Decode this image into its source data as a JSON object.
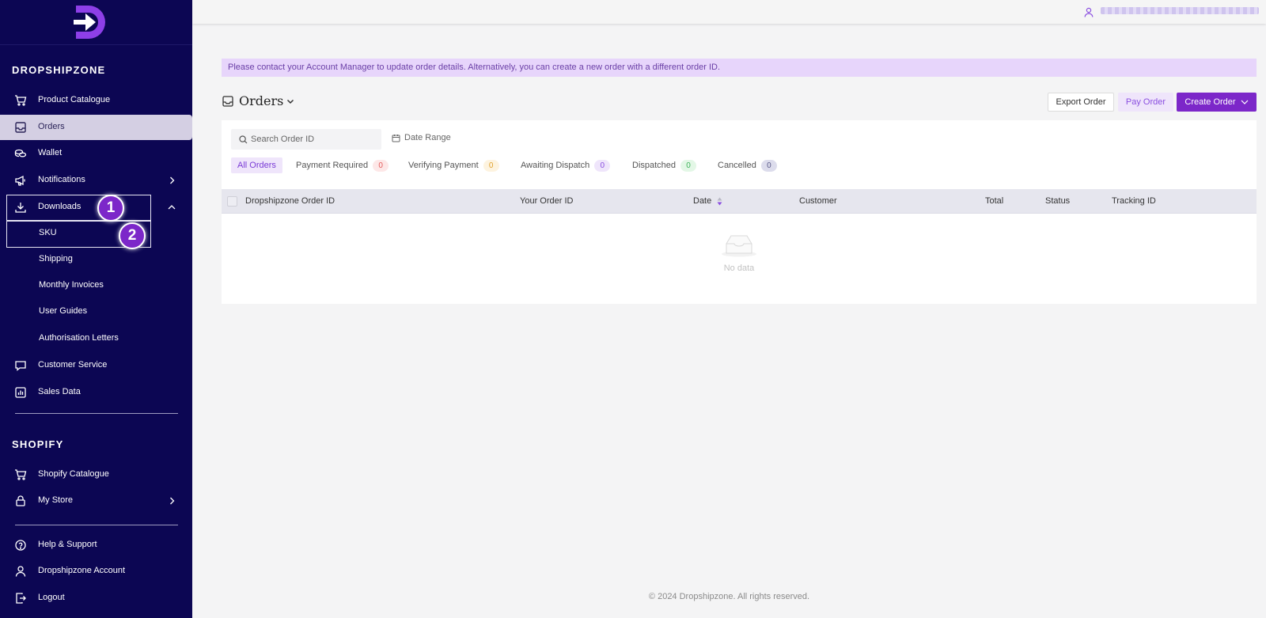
{
  "sidebar": {
    "sections": {
      "dropshipzone": "DROPSHIPZONE",
      "shopify": "SHOPIFY"
    },
    "items": {
      "product_catalogue": "Product Catalogue",
      "orders": "Orders",
      "wallet": "Wallet",
      "notifications": "Notifications",
      "downloads": "Downloads",
      "customer_service": "Customer Service",
      "sales_data": "Sales Data",
      "shopify_catalogue": "Shopify Catalogue",
      "my_store": "My Store",
      "help_support": "Help & Support",
      "account": "Dropshipzone Account",
      "logout": "Logout"
    },
    "downloads_sub": {
      "sku": "SKU",
      "shipping": "Shipping",
      "monthly_invoices": "Monthly Invoices",
      "user_guides": "User Guides",
      "authorisation_letters": "Authorisation Letters"
    },
    "annotations": {
      "step1": "1",
      "step2": "2"
    }
  },
  "notice": "Please contact your Account Manager to update order details. Alternatively, you can create a new order with a different order ID.",
  "header": {
    "title": "Orders",
    "export_label": "Export Order",
    "pay_label": "Pay Order",
    "create_label": "Create Order"
  },
  "filters": {
    "search_placeholder": "Search Order ID",
    "date_range": "Date Range"
  },
  "tabs": {
    "all": {
      "label": "All Orders"
    },
    "payment_required": {
      "label": "Payment Required",
      "count": "0"
    },
    "verifying_payment": {
      "label": "Verifying Payment",
      "count": "0"
    },
    "awaiting_dispatch": {
      "label": "Awaiting Dispatch",
      "count": "0"
    },
    "dispatched": {
      "label": "Dispatched",
      "count": "0"
    },
    "cancelled": {
      "label": "Cancelled",
      "count": "0"
    }
  },
  "table": {
    "columns": {
      "dsz_order_id": "Dropshipzone Order ID",
      "your_order_id": "Your Order ID",
      "date": "Date",
      "customer": "Customer",
      "total": "Total",
      "status": "Status",
      "tracking_id": "Tracking ID"
    },
    "empty": "No data"
  },
  "footer": "© 2024 Dropshipzone. All rights reserved.",
  "colors": {
    "sidebar_bg": "#0c0653",
    "accent": "#7c27c9",
    "notice_bg": "#e7d5fb"
  }
}
